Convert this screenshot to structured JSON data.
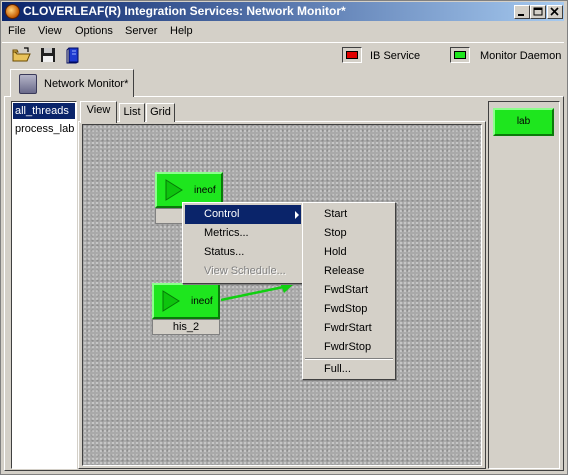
{
  "window": {
    "title": "CLOVERLEAF(R) Integration Services: Network Monitor*",
    "buttons": [
      "minimize",
      "maximize",
      "close"
    ]
  },
  "menu": {
    "items": [
      "File",
      "View",
      "Options",
      "Server",
      "Help"
    ]
  },
  "toolbar": {
    "icons": [
      "open-folder-icon",
      "save-icon",
      "book-icon"
    ],
    "ib_service_label": "IB Service",
    "ib_service_color": "#e00000",
    "monitor_daemon_label": "Monitor Daemon",
    "monitor_daemon_color": "#1ee61e"
  },
  "main_tab": {
    "label": "Network Monitor*"
  },
  "threads": {
    "items": [
      "all_threads",
      "process_lab"
    ],
    "selected": "all_threads"
  },
  "view_tabs": {
    "items": [
      "View",
      "List",
      "Grid"
    ],
    "active": "View"
  },
  "nodes": [
    {
      "label": "ineof",
      "name": "h",
      "status_color": "#1ee61e"
    },
    {
      "label": "ineof",
      "name": "his_2",
      "status_color": "#1ee61e"
    }
  ],
  "process_panel": {
    "button_label": "lab",
    "button_color": "#1ee61e"
  },
  "context_menu": {
    "items": [
      "Control",
      "Metrics...",
      "Status...",
      "View Schedule..."
    ],
    "highlighted": "Control",
    "disabled": "View Schedule..."
  },
  "control_submenu": {
    "items": [
      "Start",
      "Stop",
      "Hold",
      "Release",
      "FwdStart",
      "FwdStop",
      "FwdrStart",
      "FwdrStop"
    ],
    "footer": "Full..."
  }
}
